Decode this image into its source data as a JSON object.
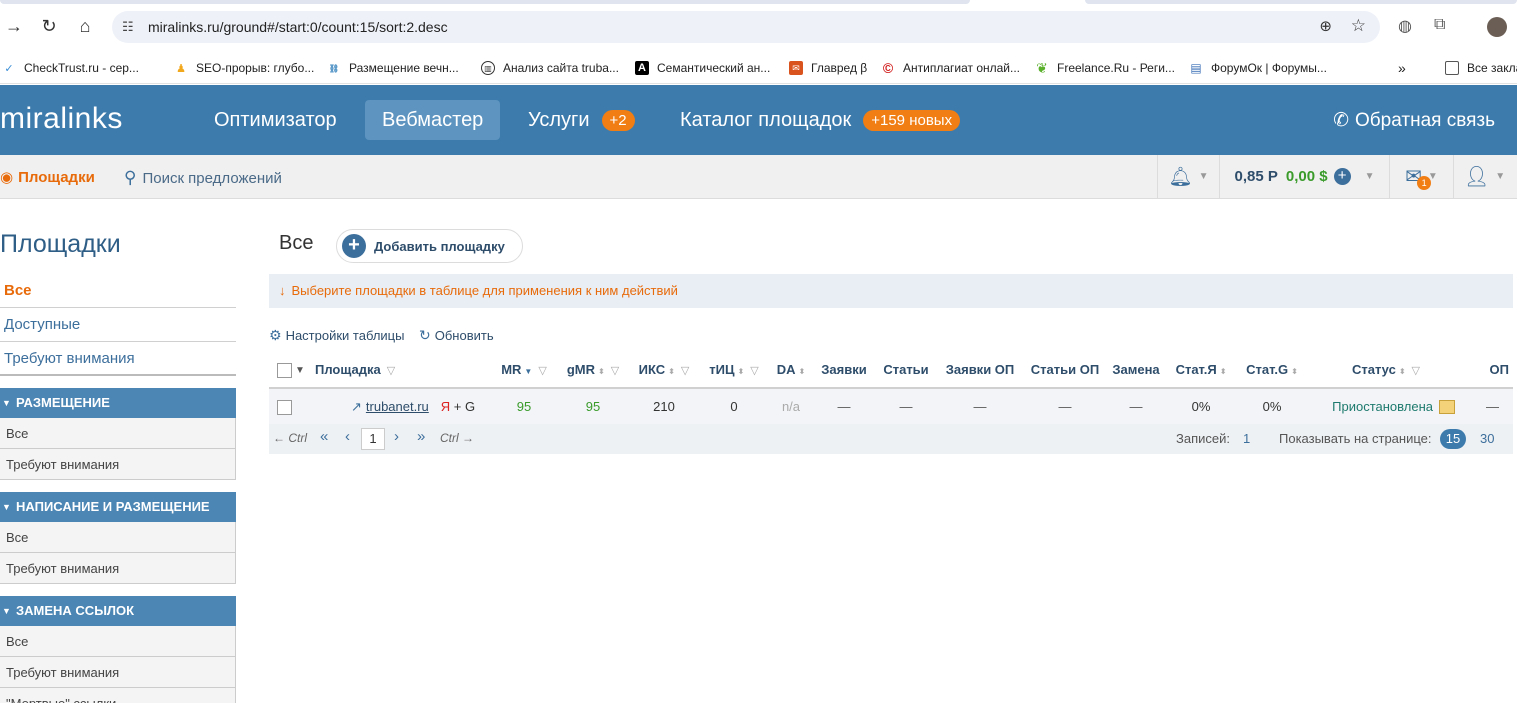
{
  "browser": {
    "url": "miralinks.ru/ground#/start:0/count:15/sort:2.desc",
    "bookmarks": [
      {
        "label": "CheckTrust.ru - сер...",
        "icon": "checkmark-icon",
        "color": "#3b8fd6"
      },
      {
        "label": "SEO-прорыв: глубо...",
        "icon": "person-icon",
        "color": "#f2a81c"
      },
      {
        "label": "Размещение вечн...",
        "icon": "links-icon",
        "color": "#4a8fc4"
      },
      {
        "label": "Анализ сайта truba...",
        "icon": "chart-icon",
        "color": "#333333"
      },
      {
        "label": "Семантический ан...",
        "icon": "a-letter-icon",
        "color": "#000000"
      },
      {
        "label": "Главред β",
        "icon": "glavred-icon",
        "color": "#d9531e"
      },
      {
        "label": "Антиплагиат онлай...",
        "icon": "copyright-icon",
        "color": "#d11a1a"
      },
      {
        "label": "Freelance.Ru - Реги...",
        "icon": "leaf-icon",
        "color": "#5ab02b"
      },
      {
        "label": "ФорумОк | Форумы...",
        "icon": "forum-icon",
        "color": "#3b6fb6"
      }
    ],
    "all_bookmarks": "Все закла"
  },
  "header": {
    "logo": "miralinks",
    "nav": [
      {
        "label": "Оптимизатор",
        "badge": ""
      },
      {
        "label": "Вебмастер",
        "badge": "",
        "active": true
      },
      {
        "label": "Услуги",
        "badge": "+2"
      },
      {
        "label": "Каталог площадок",
        "badge": "+159 новых"
      }
    ],
    "feedback": "Обратная связь"
  },
  "subnav": {
    "places": "Площадки",
    "search": "Поиск предложений",
    "balance_rub": "0,85 Р",
    "balance_usd": "0,00 $",
    "mail_count": "1"
  },
  "sidebar": {
    "title": "Площадки",
    "links": [
      "Все",
      "Доступные",
      "Требуют внимания"
    ],
    "sections": [
      {
        "title": "РАЗМЕЩЕНИЕ",
        "items": [
          "Все",
          "Требуют внимания"
        ]
      },
      {
        "title": "НАПИСАНИЕ И РАЗМЕЩЕНИЕ",
        "items": [
          "Все",
          "Требуют внимания"
        ]
      },
      {
        "title": "ЗАМЕНА ССЫЛОК",
        "items": [
          "Все",
          "Требуют внимания",
          "\"Мертвые\" ссылки"
        ]
      }
    ]
  },
  "main": {
    "title": "Все",
    "add_button": "Добавить площадку",
    "hint": "Выберите площадки в таблице для применения к ним действий",
    "table_settings": "Настройки таблицы",
    "refresh": "Обновить",
    "columns": [
      "Площадка",
      "MR",
      "gMR",
      "ИКС",
      "тИЦ",
      "DA",
      "Заявки",
      "Статьи",
      "Заявки ОП",
      "Статьи ОП",
      "Замена",
      "Стат.Я",
      "Стат.G",
      "Статус",
      "ОП"
    ],
    "row": {
      "site": "trubanet.ru",
      "engines_y": "Я",
      "engines_g": "+ G",
      "mr": "95",
      "gmr": "95",
      "iks": "210",
      "tic": "0",
      "da": "n/a",
      "requests": "—",
      "articles": "—",
      "requests_op": "—",
      "articles_op": "—",
      "replace": "—",
      "stat_y": "0%",
      "stat_g": "0%",
      "status": "Приостановлена",
      "op": "—"
    },
    "pager": {
      "prev_ctrl": "← Ctrl",
      "first": "«",
      "prev": "‹",
      "current": "1",
      "next": "›",
      "last": "»",
      "next_ctrl": "Ctrl →",
      "records_label": "Записей:",
      "records": "1",
      "per_page_label": "Показывать на странице:",
      "per_page_active": "15",
      "per_page_other": "30"
    }
  }
}
